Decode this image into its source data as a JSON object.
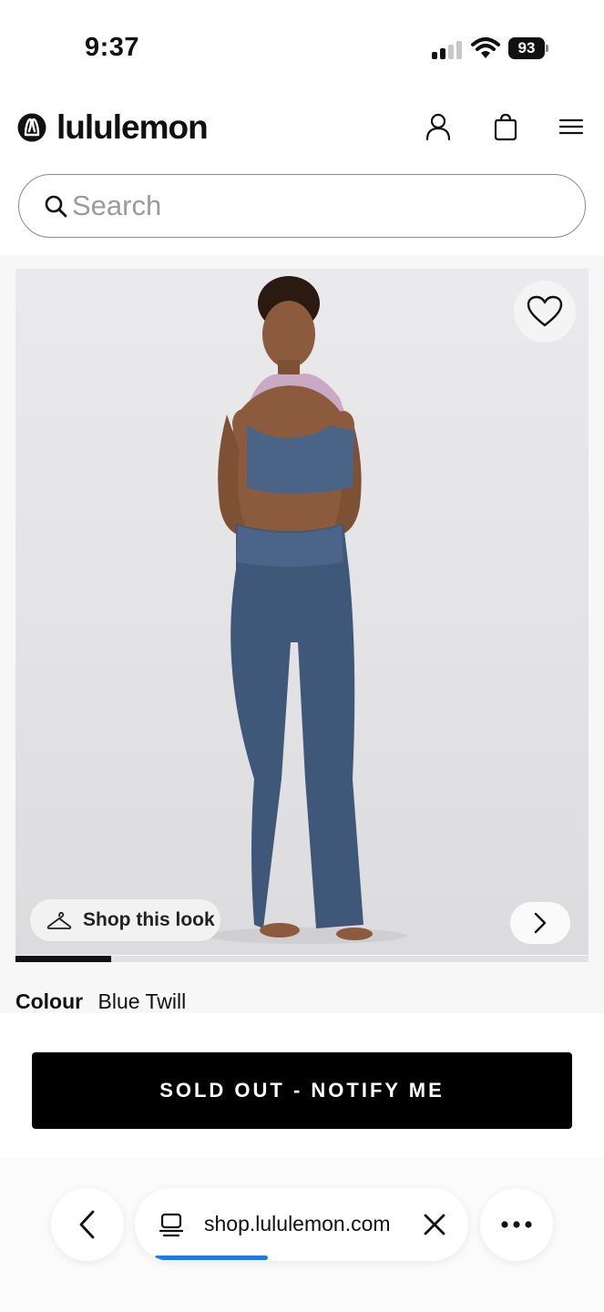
{
  "status_bar": {
    "time": "9:37",
    "battery": "93",
    "icons": [
      "signal-icon",
      "wifi-icon",
      "battery-icon"
    ]
  },
  "header": {
    "brand": "lululemon",
    "icons": [
      "lululemon-logo-icon",
      "account-icon",
      "bag-icon",
      "menu-icon"
    ]
  },
  "search": {
    "placeholder": "Search",
    "value": ""
  },
  "product": {
    "gallery_progress": 0.1667,
    "favorite_icon": "heart-icon",
    "shop_this_look": "Shop this look",
    "shop_look_icon": "hanger-icon",
    "next_icon": "chevron-right-icon",
    "colour_label": "Colour",
    "colour_value": "Blue Twill",
    "cta_label": "SOLD OUT - NOTIFY ME"
  },
  "browser": {
    "url": "shop.lululemon.com",
    "load_progress": 0.34,
    "icons": [
      "back-icon",
      "tabs-icon",
      "close-icon",
      "more-icon"
    ]
  },
  "colors": {
    "cta_background": "#000000",
    "load_bar": "#1e7ae6",
    "garment": "#3f5879"
  }
}
